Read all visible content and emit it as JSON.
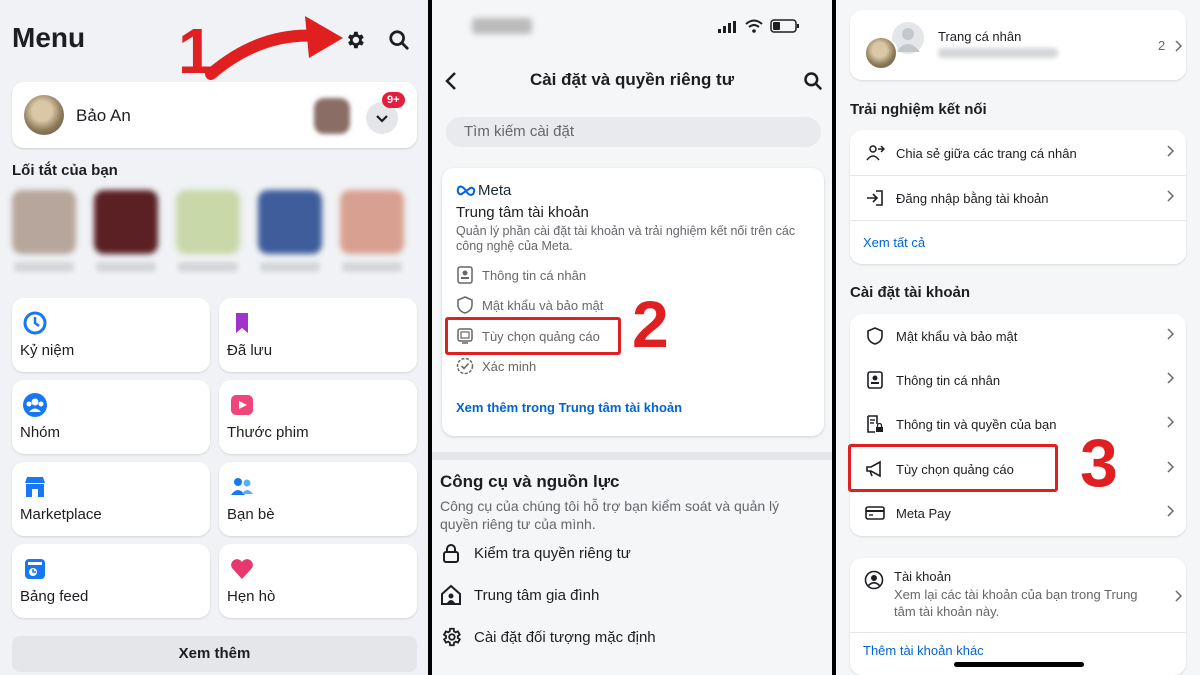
{
  "panel1": {
    "title": "Menu",
    "step": "1",
    "profile_name": "Bảo An",
    "notification_badge": "9+",
    "shortcuts_title": "Lối tắt của bạn",
    "tiles": [
      {
        "label": "Kỷ niệm",
        "icon": "clock-history-icon"
      },
      {
        "label": "Đã lưu",
        "icon": "bookmark-icon"
      },
      {
        "label": "Nhóm",
        "icon": "groups-icon"
      },
      {
        "label": "Thước phim",
        "icon": "reels-icon"
      },
      {
        "label": "Marketplace",
        "icon": "marketplace-icon"
      },
      {
        "label": "Bạn bè",
        "icon": "friends-icon"
      },
      {
        "label": "Bảng feed",
        "icon": "feed-icon"
      },
      {
        "label": "Hẹn hò",
        "icon": "dating-heart-icon"
      }
    ],
    "see_more": "Xem thêm"
  },
  "panel2": {
    "header": "Cài đặt và quyền riêng tư",
    "search_placeholder": "Tìm kiếm cài đặt",
    "meta_logo": "Meta",
    "account_center_title": "Trung tâm tài khoản",
    "account_center_desc": "Quản lý phần cài đặt tài khoản và trải nghiệm kết nối trên các công nghệ của Meta.",
    "items": [
      {
        "label": "Thông tin cá nhân",
        "icon": "id-card-icon"
      },
      {
        "label": "Mật khẩu và bảo mật",
        "icon": "shield-icon"
      },
      {
        "label": "Tùy chọn quảng cáo",
        "icon": "monitor-icon"
      },
      {
        "label": "Xác minh",
        "icon": "verified-badge-icon"
      }
    ],
    "account_center_link": "Xem thêm trong Trung tâm tài khoản",
    "step": "2",
    "tools_title": "Công cụ và nguồn lực",
    "tools_desc": "Công cụ của chúng tôi hỗ trợ bạn kiểm soát và quản lý quyền riêng tư của mình.",
    "tools": [
      {
        "label": "Kiểm tra quyền riêng tư",
        "icon": "lock-icon"
      },
      {
        "label": "Trung tâm gia đình",
        "icon": "family-home-icon"
      },
      {
        "label": "Cài đặt đối tượng mặc định",
        "icon": "gear-icon"
      }
    ]
  },
  "panel3": {
    "profile_label": "Trang cá nhân",
    "profile_count": "2",
    "connected_title": "Trải nghiệm kết nối",
    "connected_items": [
      {
        "label": "Chia sẻ giữa các trang cá nhân",
        "icon": "share-profiles-icon"
      },
      {
        "label": "Đăng nhập bằng tài khoản",
        "icon": "login-icon"
      }
    ],
    "see_all": "Xem tất cả",
    "account_settings_title": "Cài đặt tài khoản",
    "account_items": [
      {
        "label": "Mật khẩu và bảo mật",
        "icon": "shield-icon"
      },
      {
        "label": "Thông tin cá nhân",
        "icon": "id-card-icon"
      },
      {
        "label": "Thông tin và quyền của bạn",
        "icon": "document-lock-icon"
      },
      {
        "label": "Tùy chọn quảng cáo",
        "icon": "megaphone-icon"
      },
      {
        "label": "Meta Pay",
        "icon": "credit-card-icon"
      }
    ],
    "step": "3",
    "accounts_title": "Tài khoản",
    "accounts_desc": "Xem lại các tài khoản của bạn trong Trung tâm tài khoản này.",
    "add_account": "Thêm tài khoản khác"
  },
  "colors": {
    "accent": "#0064d1",
    "highlight": "#e02020",
    "background": "#f0f2f5"
  }
}
